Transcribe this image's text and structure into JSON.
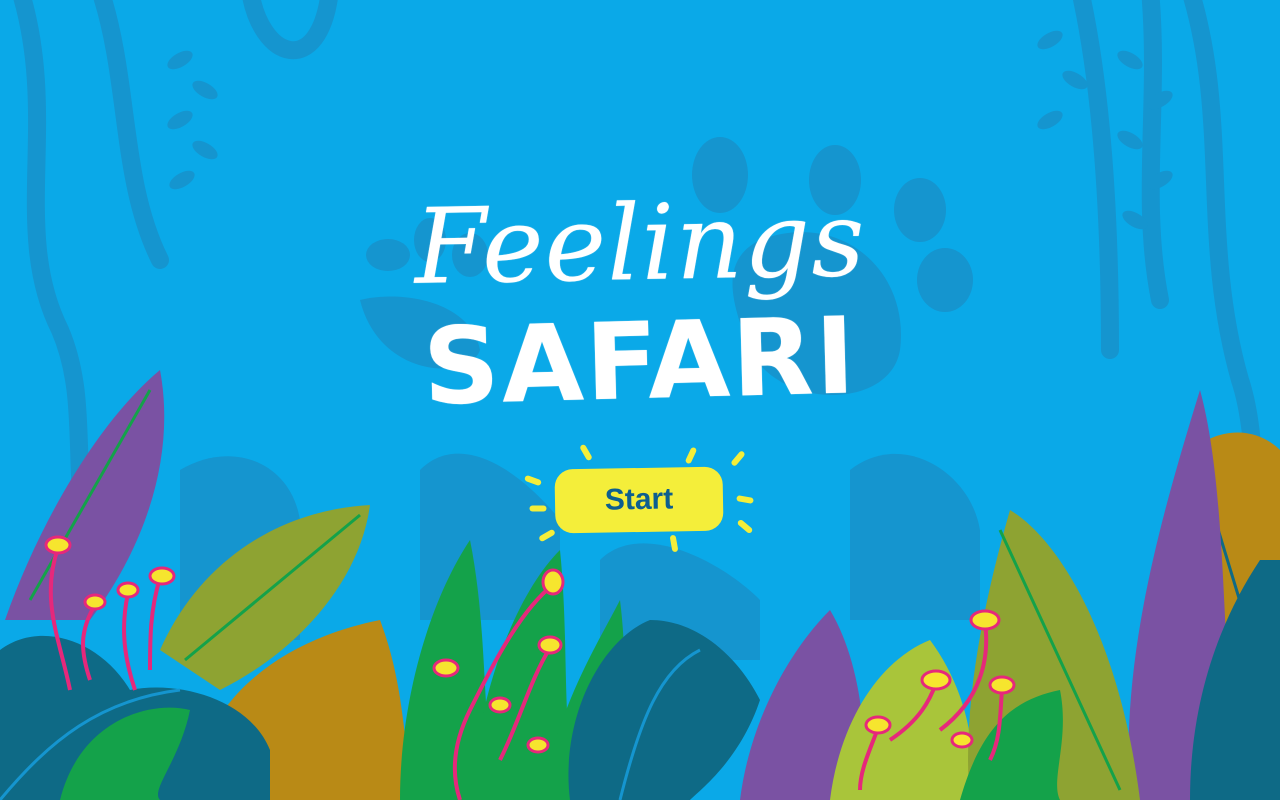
{
  "game": {
    "title_line1": "Feelings",
    "title_line2": "SAFARI",
    "start_label": "Start"
  },
  "colors": {
    "sky": "#0aa9e8",
    "silhouette": "#1595cf",
    "title": "#ffffff",
    "button": "#f4ee3a",
    "button_text": "#0d5f8f",
    "leaf_purple": "#7a52a3",
    "leaf_olive": "#8ea332",
    "leaf_green": "#14a24a",
    "leaf_teal": "#0e6a86",
    "leaf_gold": "#b98a16",
    "leaf_lime": "#a9c53a",
    "flower_stem": "#e6287b",
    "flower_head": "#f6e52e"
  },
  "icons": [
    "paw-print-icon",
    "vine-icon",
    "leaf-icon",
    "flower-icon",
    "sparkle-icon"
  ]
}
